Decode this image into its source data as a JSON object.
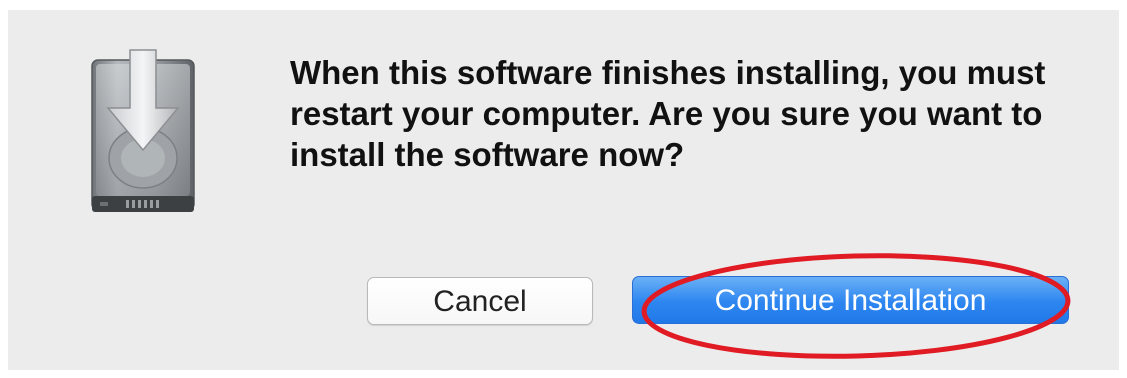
{
  "dialog": {
    "message": "When this software finishes installing, you must restart your computer. Are you sure you want to install the software now?",
    "icon": "installer-disk-icon"
  },
  "buttons": {
    "cancel_label": "Cancel",
    "continue_label": "Continue Installation"
  },
  "annotation": {
    "highlight": "red-ellipse-around-continue-button",
    "color": "#e01b24"
  },
  "colors": {
    "dialog_background": "#ececec",
    "primary_button": "#2d86f0",
    "secondary_button": "#ffffff"
  }
}
